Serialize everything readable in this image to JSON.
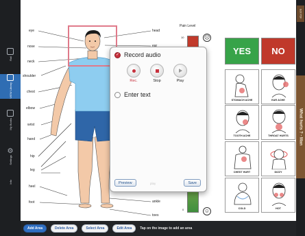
{
  "left_rail": {
    "items": [
      {
        "label": "Rail"
      },
      {
        "label": "VIEW Library",
        "active": true
      },
      {
        "label": "My Books"
      },
      {
        "label": "Settings"
      },
      {
        "label": "Info"
      }
    ]
  },
  "right_rail": {
    "top_tab": "Edit PDF",
    "main_tab": "What hurts ? - Man"
  },
  "body_labels": {
    "left": [
      "eye",
      "nose",
      "neck",
      "shoulder",
      "chest",
      "elbow",
      "wrist",
      "hand",
      "hip",
      "leg",
      "heel",
      "foot"
    ],
    "right": [
      "head",
      "ear",
      "ankle",
      "toes"
    ]
  },
  "pain_scale": {
    "title": "Pain Level",
    "top_value": "10",
    "bottom_value": "0",
    "face_top": "☹",
    "face_bottom": "☺"
  },
  "answers": {
    "yes": "YES",
    "no": "NO",
    "yes_color": "#37a349",
    "no_color": "#c0392b"
  },
  "symptoms": [
    {
      "label": "STOMACH ACHE"
    },
    {
      "label": "EAR ACHE"
    },
    {
      "label": "TOOTH ACHE"
    },
    {
      "label": "THROAT HURTS"
    },
    {
      "label": "CHEST HURT"
    },
    {
      "label": "DIZZY"
    },
    {
      "label": "COLD"
    },
    {
      "label": "HOT"
    }
  ],
  "dialog": {
    "record_audio_label": "Record audio",
    "record_audio_selected": true,
    "enter_text_label": "Enter text",
    "rec_label": "Rec.",
    "stop_label": "Stop",
    "play_label": "Play",
    "preview_label": "Preview",
    "save_label": "Save",
    "faded_hint": "play"
  },
  "toolbar": {
    "add_area": "Add Area",
    "delete_area": "Delete Area",
    "select_area": "Select Area",
    "edit_area": "Edit Area",
    "hint": "Tap on the image to add an area"
  },
  "colors": {
    "accent_red": "#c7313d",
    "selection_box": "#e07a8a",
    "toolbar_blue": "#2f6fc2"
  }
}
